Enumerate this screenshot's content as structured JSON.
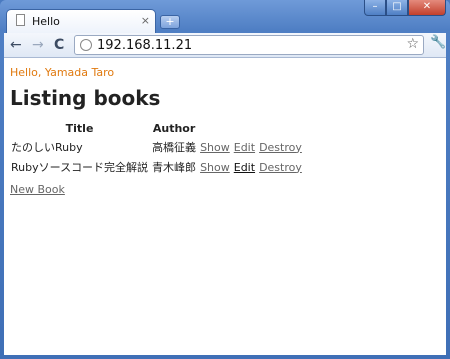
{
  "window": {
    "controls": {
      "minimize": "–",
      "maximize": "□",
      "close": "✕"
    }
  },
  "tab": {
    "title": "Hello",
    "close": "×"
  },
  "toolbar": {
    "back": "←",
    "forward": "→",
    "reload": "C",
    "url": "192.168.11.21"
  },
  "page": {
    "greeting": "Hello, Yamada Taro",
    "heading": "Listing books",
    "table": {
      "headers": [
        "Title",
        "Author"
      ],
      "rows": [
        {
          "title": "たのしいRuby",
          "author": "高橋征義",
          "show": "Show",
          "edit": "Edit",
          "destroy": "Destroy"
        },
        {
          "title": "Rubyソースコード完全解説",
          "author": "青木峰郎",
          "show": "Show",
          "edit": "Edit",
          "destroy": "Destroy"
        }
      ]
    },
    "new_book": "New Book"
  },
  "colors": {
    "frame": "#4f7fc4",
    "greeting": "#e07a10",
    "link": "#666666"
  }
}
